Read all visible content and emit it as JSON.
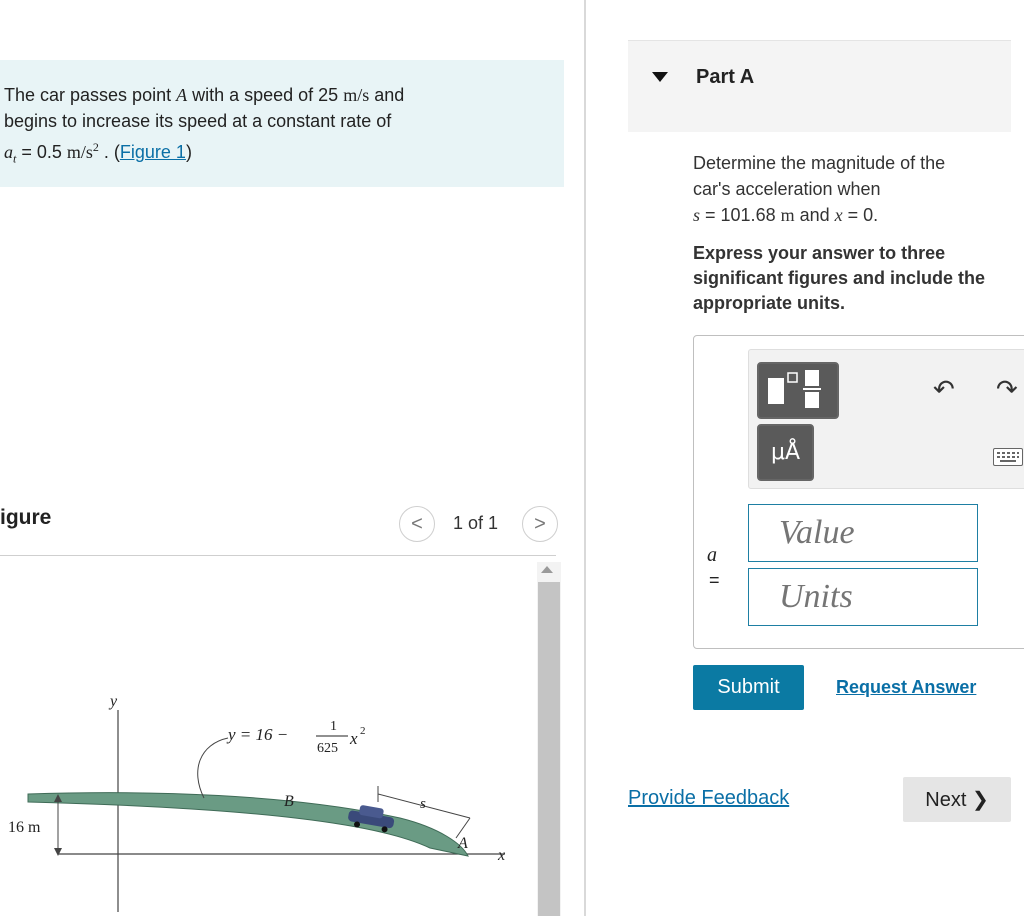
{
  "problem": {
    "line1_prefix": "The car passes point ",
    "point": "A",
    "line1_suffix": " with a speed of 25 ",
    "speed_unit": "m/s",
    "line1_end": " and",
    "line2": "begins to increase its speed at a constant rate of",
    "at_symbol": "a",
    "at_sub": "t",
    "at_eq": " = 0.5 ",
    "at_unit": "m/s",
    "at_unit_exp": "2",
    "figure_link_prefix": " . (",
    "figure_link": "Figure 1",
    "figure_link_suffix": ")"
  },
  "figure_panel": {
    "title": "igure",
    "prev_label": "<",
    "next_label": ">",
    "counter": "1 of 1",
    "figure": {
      "axis_y": "y",
      "axis_x": "x",
      "equation_lhs": "y = 16 −",
      "frac_num": "1",
      "frac_den": "625",
      "equation_rhs": "x",
      "equation_exp": "2",
      "label_b": "B",
      "label_a": "A",
      "label_s": "s",
      "height_label": "16 m"
    }
  },
  "part": {
    "title": "Part A",
    "question_line1": "Determine the magnitude of the",
    "question_line2": "car's acceleration when",
    "q_s": "s",
    "q_s_val": " = 101.68 ",
    "q_s_unit": "m",
    "q_and": " and ",
    "q_x": "x",
    "q_x_val": " = 0.",
    "instructions": "Express your answer to three significant figures and include the appropriate units."
  },
  "answer": {
    "units_tool_label": "μÅ",
    "undo_icon": "↶",
    "redo_icon": "↷",
    "variable": "a",
    "equals": "=",
    "value_placeholder": "Value",
    "units_placeholder": "Units",
    "submit_label": "Submit",
    "request_answer_label": "Request Answer"
  },
  "footer": {
    "feedback_label": "Provide Feedback",
    "next_label": "Next ❯"
  },
  "colors": {
    "accent": "#0b7aa3",
    "link": "#0a6fa6",
    "problem_bg": "#e8f4f6",
    "road": "#6a9b84"
  }
}
